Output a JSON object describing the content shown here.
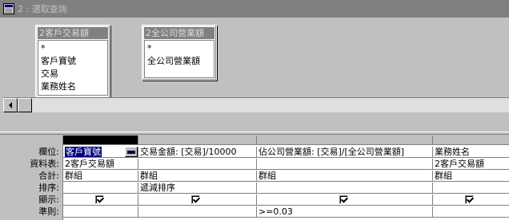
{
  "window": {
    "title": "2 : 選取查詢"
  },
  "tables": [
    {
      "title": "2客戶交易額",
      "fields": [
        "*",
        "客戶寶號",
        "交易",
        "業務姓名"
      ]
    },
    {
      "title": "2全公司營業額",
      "fields": [
        "*",
        "全公司營業額"
      ]
    }
  ],
  "grid": {
    "row_labels": [
      "欄位:",
      "資料表:",
      "合計:",
      "排序:",
      "顯示:",
      "準則:"
    ],
    "columns": [
      {
        "field": "客戶寶號",
        "table": "2客戶交易額",
        "total": "群組",
        "sort": "",
        "show": true,
        "criteria": ""
      },
      {
        "field": "交易金額: [交易]/10000",
        "table": "",
        "total": "群組",
        "sort": "遞減排序",
        "show": true,
        "criteria": ""
      },
      {
        "field": "佔公司營業額: [交易]/[全公司營業額]",
        "table": "",
        "total": "群組",
        "sort": "",
        "show": true,
        "criteria": ">=0.03"
      },
      {
        "field": "業務姓名",
        "table": "2客戶交易額",
        "total": "群組",
        "sort": "",
        "show": true,
        "criteria": ""
      }
    ]
  }
}
